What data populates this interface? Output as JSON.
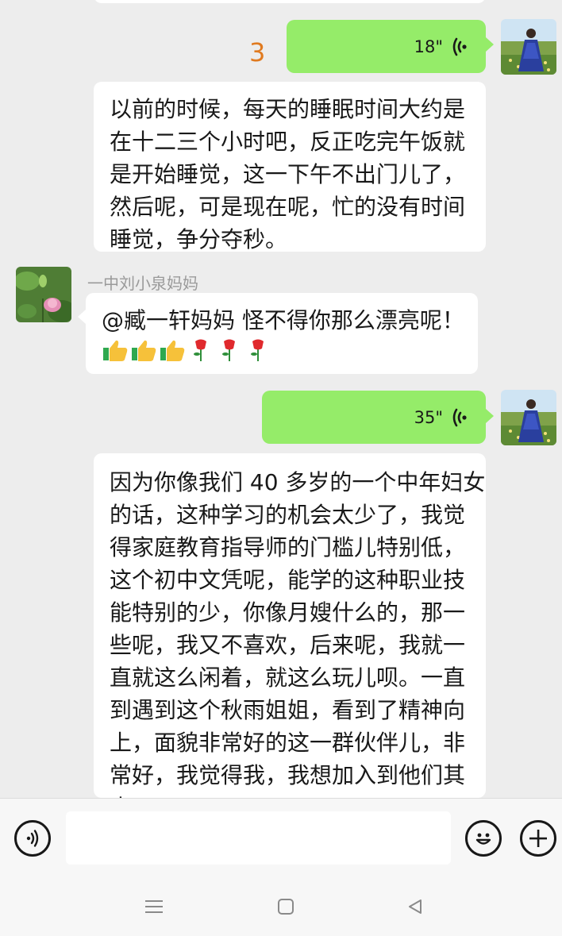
{
  "messages": [
    {
      "type": "voice",
      "side": "right",
      "duration": "18\"",
      "unread_count": "3"
    },
    {
      "type": "text",
      "side": "right",
      "lines": [
        "以前的时候，每天的睡眠时间大约是",
        "在十二三个小时吧，反正吃完午饭就",
        "是开始睡觉，这一下午不出门儿了，",
        "然后呢，可是现在呢，忙的没有时间",
        "睡觉，争分夺秒。"
      ]
    },
    {
      "type": "text",
      "side": "left",
      "sender": "一中刘小泉妈妈",
      "text": "@臧一轩妈妈  怪不得你那么漂亮呢！",
      "emojis": [
        "thumbs-up",
        "thumbs-up",
        "thumbs-up",
        "rose",
        "rose",
        "rose"
      ]
    },
    {
      "type": "voice",
      "side": "right",
      "duration": "35\""
    },
    {
      "type": "text",
      "side": "right",
      "lines": [
        "因为你像我们 40 多岁的一个中年妇女",
        "的话，这种学习的机会太少了，我觉",
        "得家庭教育指导师的门槛儿特别低，",
        "这个初中文凭呢，能学的这种职业技",
        "能特别的少，你像月嫂什么的，那一",
        "些呢，我又不喜欢，后来呢，我就一",
        "直就这么闲着，就这么玩儿呗。一直",
        "到遇到这个秋雨姐姐，看到了精神向",
        "上，面貌非常好的这一群伙伴儿，非",
        "常好，我觉得我，我想加入到他们其",
        "中。"
      ]
    }
  ],
  "input": {
    "value": ""
  },
  "colors": {
    "green_bubble": "#95ec69",
    "background": "#ededed",
    "unread": "#e07a1f"
  },
  "icons": {
    "voice_toggle": "voice-input-icon",
    "emoji": "emoji-icon",
    "more": "plus-icon",
    "nav": [
      "menu-icon",
      "home-icon",
      "back-icon"
    ]
  }
}
